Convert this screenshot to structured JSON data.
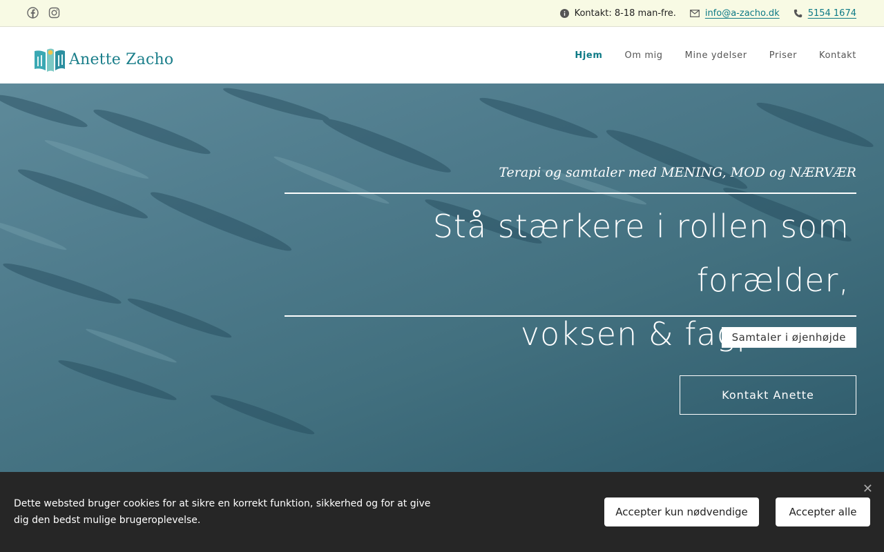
{
  "topbar": {
    "social": [
      {
        "icon": "facebook-icon"
      },
      {
        "icon": "instagram-icon"
      }
    ],
    "contact_hours": "Kontakt: 8-18 man-fre.",
    "email": "info@a-zacho.dk",
    "phone": "5154 1674"
  },
  "header": {
    "logo_text": "Anette Zacho",
    "nav": [
      {
        "label": "Hjem",
        "active": true
      },
      {
        "label": "Om mig"
      },
      {
        "label": "Mine ydelser"
      },
      {
        "label": "Priser"
      },
      {
        "label": "Kontakt"
      }
    ]
  },
  "hero": {
    "tagline": "Terapi og samtaler med MENING, MOD og NÆRVÆR",
    "headline_line1": "Stå stærkere i rollen som forælder,",
    "headline_line2": "voksen & fagperson",
    "subtitle": "Samtaler i øjenhøjde",
    "cta_label": "Kontakt Anette"
  },
  "cookie_banner": {
    "text": "Dette websted bruger cookies for at sikre en korrekt funktion, sikkerhed og for at give dig den bedst mulige brugeroplevelse.",
    "close_glyph": "✕",
    "necessary_label": "Accepter kun nødvendige",
    "accept_all_label": "Accepter alle"
  },
  "colors": {
    "accent": "#0d7a86",
    "topbar_bg": "#f8fae4",
    "hero_bg": "#42707f",
    "cookie_bg": "#262626"
  }
}
